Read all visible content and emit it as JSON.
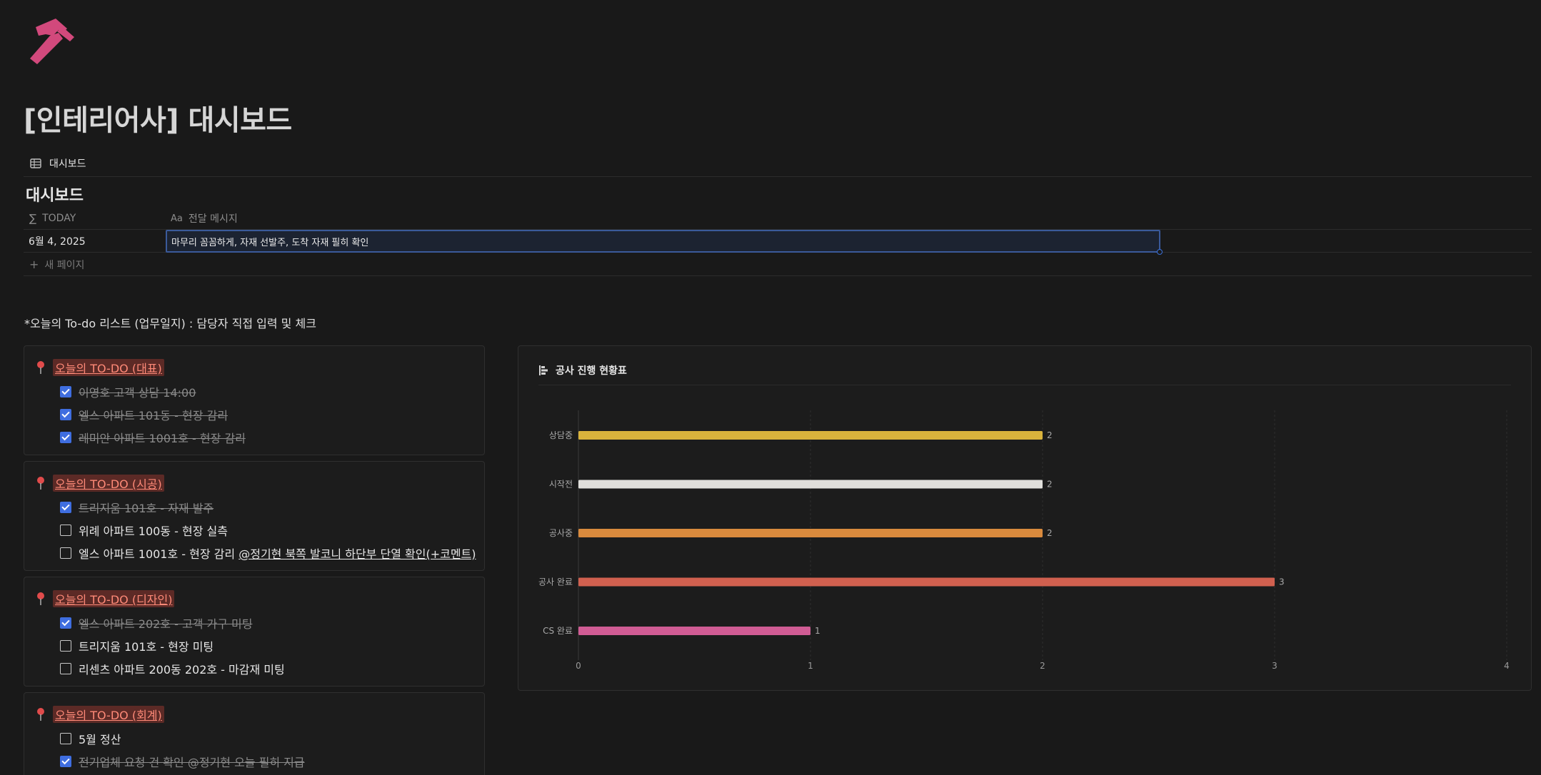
{
  "page": {
    "icon": "hammer-icon",
    "title": "[인테리어사] 대시보드"
  },
  "views": {
    "active_tab": {
      "label": "대시보드",
      "icon": "table-icon"
    }
  },
  "database": {
    "title": "대시보드",
    "columns": [
      {
        "label": "TODAY",
        "icon": "sigma-icon"
      },
      {
        "label": "전달 메시지",
        "icon": "text-property-icon",
        "icon_text": "Aa"
      }
    ],
    "rows": [
      {
        "today": "6월 4, 2025",
        "message": "마무리 꼼꼼하게, 자재 선발주, 도착 자재 필히 확인"
      }
    ],
    "new_page_label": "새 페이지"
  },
  "instruction": "*오늘의 To-do 리스트 (업무일지) : 담당자 직접 입력 및 체크",
  "todo_cards": [
    {
      "title": "오늘의 TO-DO (대표)",
      "items": [
        {
          "text": "이영호 고객 상담 14:00",
          "checked": true
        },
        {
          "text": "엘스 아파트 101동 - 현장 감리",
          "checked": true
        },
        {
          "text": "레미안 아파트 1001호 - 현장 감리",
          "checked": true
        }
      ]
    },
    {
      "title": "오늘의 TO-DO (시공)",
      "items": [
        {
          "text": "트리지움 101호 - 자재 발주",
          "checked": true
        },
        {
          "text": "위례 아파트 100동 - 현장 실측",
          "checked": false
        },
        {
          "text": "엘스 아파트 1001호 - 현장 감리 ",
          "mention": "@정기현 북쪽 발코니 하단부 단열 확인(+코멘트)",
          "checked": false
        }
      ]
    },
    {
      "title": "오늘의 TO-DO (디자인)",
      "items": [
        {
          "text": "엘스 아파트 202호 - 고객 가구 미팅",
          "checked": true
        },
        {
          "text": "트리지움 101호 - 현장 미팅",
          "checked": false
        },
        {
          "text": "리센츠 아파트 200동 202호 - 마감재 미팅",
          "checked": false
        }
      ]
    },
    {
      "title": "오늘의 TO-DO (회계)",
      "items": [
        {
          "text": "5월 정산",
          "checked": false
        },
        {
          "text": "전기업체 요청 건 확인 @정기현 오늘 필히 지급",
          "checked": true
        }
      ]
    }
  ],
  "chart_card": {
    "title": "공사 진행 현황표",
    "icon": "bar-chart-icon"
  },
  "chart_data": {
    "type": "bar",
    "orientation": "horizontal",
    "categories": [
      "상담중",
      "시작전",
      "공사중",
      "공사 완료",
      "CS 완료"
    ],
    "values": [
      2,
      2,
      2,
      3,
      1
    ],
    "colors": [
      "#d9b33c",
      "#e0dfdb",
      "#d98a3d",
      "#d0604f",
      "#d05c94"
    ],
    "xlim": [
      0,
      4
    ],
    "xticks": [
      0,
      1,
      2,
      3,
      4
    ],
    "data_labels": true,
    "grid": "vertical-dashed"
  }
}
